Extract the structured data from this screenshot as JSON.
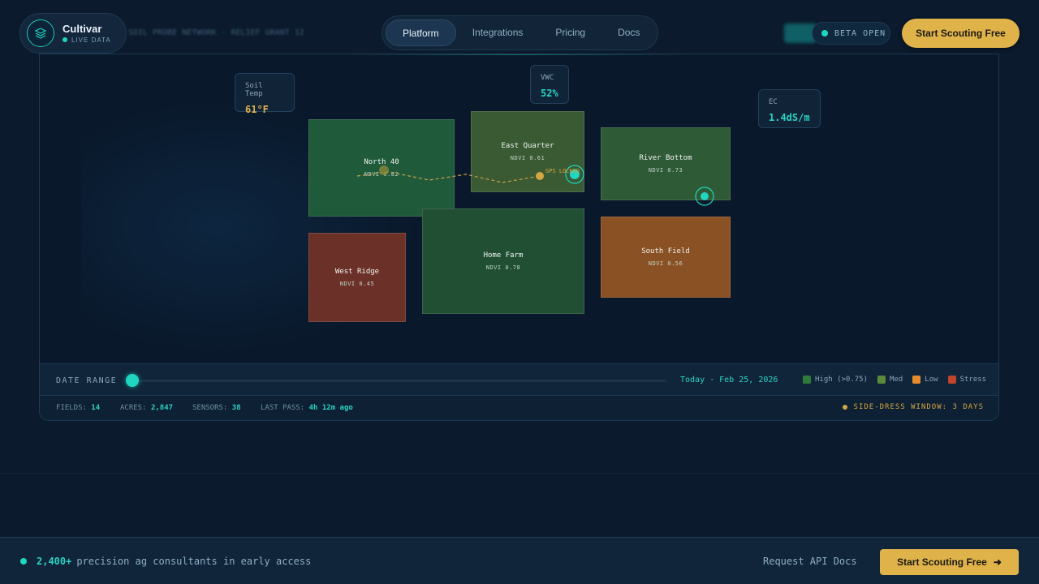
{
  "brand": {
    "name": "Cultivar",
    "status": "LIVE DATA"
  },
  "ticker": "SOIL PROBE NETWORK · RELIEF GRANT 12",
  "nav": {
    "items": [
      "Platform",
      "Integrations",
      "Pricing",
      "Docs"
    ],
    "active": "Platform"
  },
  "beta": {
    "label": "BETA OPEN"
  },
  "header_cta": "Start Scouting Free",
  "sensors": {
    "soil_temp": {
      "label": "Soil Temp",
      "value": "61°F",
      "color": "#e0b24a"
    },
    "vwc": {
      "label": "VWC",
      "value": "52%",
      "color": "#2bd3c2"
    },
    "ec": {
      "label": "EC",
      "value": "1.4dS/m",
      "color": "#2bd3c2"
    }
  },
  "fields": [
    {
      "name": "North 40",
      "ndvi": "NDVI 0.82",
      "color": "#1f5a3a"
    },
    {
      "name": "East Quarter",
      "ndvi": "NDVI 0.61",
      "color": "#3a5a34"
    },
    {
      "name": "River Bottom",
      "ndvi": "NDVI 0.73",
      "color": "#2f5a36"
    },
    {
      "name": "Home Farm",
      "ndvi": "NDVI 0.78",
      "color": "#204f34"
    },
    {
      "name": "West Ridge",
      "ndvi": "NDVI 0.45",
      "color": "#6b3128"
    },
    {
      "name": "South Field",
      "ndvi": "NDVI 0.56",
      "color": "#8a5124"
    }
  ],
  "gps_label": "GPS LOCKED",
  "timeline": {
    "label": "DATE RANGE",
    "date": "Today · Feb 25, 2026",
    "position": 0.0
  },
  "legend": [
    {
      "label": "High (>0.75)",
      "color": "#2f7a3a"
    },
    {
      "label": "Med",
      "color": "#5a8a3a"
    },
    {
      "label": "Low",
      "color": "#e88a2a"
    },
    {
      "label": "Stress",
      "color": "#c0452a"
    }
  ],
  "stats": {
    "fields_label": "FIELDS:",
    "fields_value": "14",
    "acres_label": "ACRES:",
    "acres_value": "2,847",
    "sensors_label": "SENSORS:",
    "sensors_value": "38",
    "pass_label": "LAST PASS:",
    "pass_value": "4h 12m ago",
    "sidedress": "SIDE-DRESS WINDOW: 3 DAYS"
  },
  "footer": {
    "count": "2,400+",
    "text": "precision ag consultants in early access",
    "link": "Request API Docs",
    "cta": "Start Scouting Free"
  }
}
